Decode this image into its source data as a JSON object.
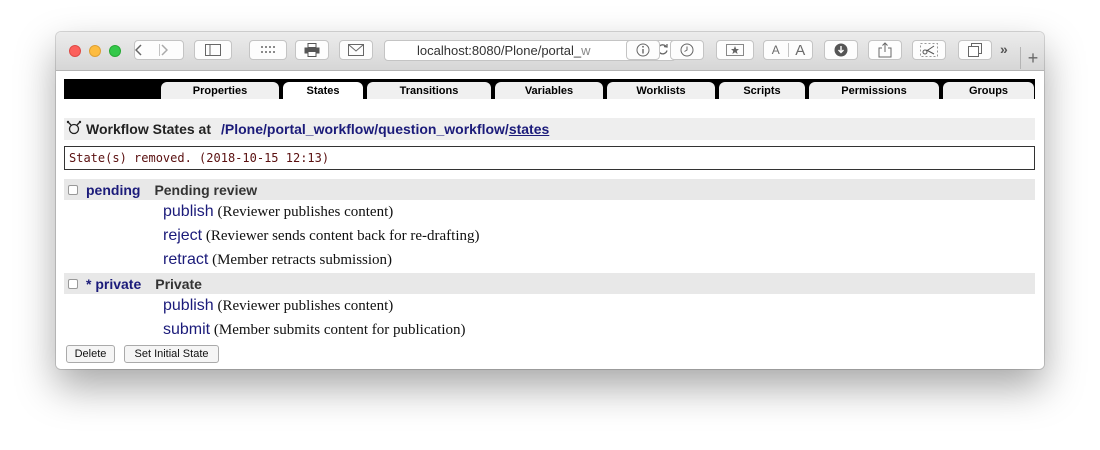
{
  "browser": {
    "url_text": "localhost:8080/Plone/portal_",
    "url_fade": "w",
    "font_small_label": "A",
    "font_large_label": "A",
    "new_tab_label": "+"
  },
  "tabs": [
    {
      "label": "Properties",
      "active": false
    },
    {
      "label": "States",
      "active": true
    },
    {
      "label": "Transitions",
      "active": false
    },
    {
      "label": "Variables",
      "active": false
    },
    {
      "label": "Worklists",
      "active": false
    },
    {
      "label": "Scripts",
      "active": false
    },
    {
      "label": "Permissions",
      "active": false
    },
    {
      "label": "Groups",
      "active": false
    }
  ],
  "heading": {
    "title": "Workflow States at",
    "path_prefix": "/Plone/portal_workflow/question_workflow/",
    "path_link": "states"
  },
  "message": "State(s) removed. (2018-10-15 12:13)",
  "states": [
    {
      "id": "pending",
      "title": "Pending review",
      "transitions": [
        {
          "id": "publish",
          "desc": "(Reviewer publishes content)"
        },
        {
          "id": "reject",
          "desc": "(Reviewer sends content back for re-drafting)"
        },
        {
          "id": "retract",
          "desc": "(Member retracts submission)"
        }
      ]
    },
    {
      "id": "* private",
      "title": "Private",
      "transitions": [
        {
          "id": "publish",
          "desc": "(Reviewer publishes content)"
        },
        {
          "id": "submit",
          "desc": "(Member submits content for publication)"
        }
      ]
    }
  ],
  "buttons": {
    "delete": "Delete",
    "set_initial": "Set Initial State"
  },
  "colors": {
    "link": "#1b1b7a",
    "message_text": "#5a1010",
    "tab_bar": "#000000"
  }
}
